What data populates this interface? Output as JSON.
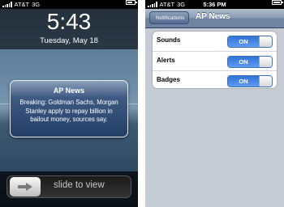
{
  "left_phone": {
    "statusbar": {
      "carrier": "AT&T",
      "network": "3G"
    },
    "lock": {
      "time": "5:43",
      "date": "Tuesday, May 18"
    },
    "notification": {
      "title": "AP News",
      "message": "Breaking: Goldman Sachs, Morgan Stanley apply to repay  billion in bailout money, sources say."
    },
    "slider": {
      "label": "slide to view"
    }
  },
  "right_phone": {
    "statusbar": {
      "carrier": "AT&T",
      "network": "3G",
      "time": "5:36 PM"
    },
    "navbar": {
      "back_label": "Notifications",
      "title": "AP News"
    },
    "settings": [
      {
        "label": "Sounds",
        "state": "ON"
      },
      {
        "label": "Alerts",
        "state": "ON"
      },
      {
        "label": "Badges",
        "state": "ON"
      }
    ]
  },
  "colors": {
    "toggle_on": "#2f74d6",
    "nav_bar": "#6e83a0",
    "settings_bg": "#c5ccd4"
  },
  "icons": [
    "signal-bars-icon",
    "battery-icon",
    "slide-arrow-icon",
    "back-chevron-icon"
  ]
}
